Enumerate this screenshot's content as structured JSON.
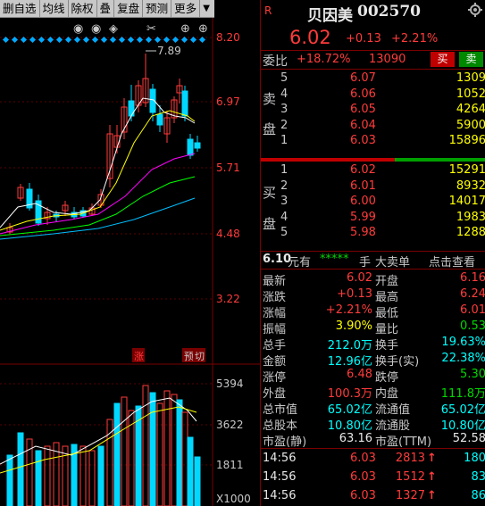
{
  "toolbar": {
    "items": [
      "删自选",
      "均线",
      "除权",
      "叠",
      "复盘",
      "预测",
      "更多"
    ],
    "dropdown_glyph": "▼"
  },
  "chart": {
    "price_axis": [
      "8.20",
      "6.97",
      "5.71",
      "4.48",
      "3.22"
    ],
    "volume_axis": [
      "5394",
      "3622",
      "1811"
    ],
    "volume_unit": "X1000",
    "high_marker": "7.89",
    "markers": [
      "涨",
      "预",
      "切"
    ]
  },
  "quote": {
    "flag": "R",
    "name": "贝因美",
    "code": "002570",
    "price": "6.02",
    "change": "+0.13",
    "change_pct": "+2.21%",
    "weibi_label": "委比",
    "weibi_value": "+18.72%",
    "weicha_value": "13090",
    "buy_button": "买",
    "sell_button": "卖"
  },
  "sell_side": {
    "side_label": [
      "卖",
      "盘"
    ],
    "rows": [
      {
        "level": "5",
        "price": "6.07",
        "volume": "1309"
      },
      {
        "level": "4",
        "price": "6.06",
        "volume": "1052"
      },
      {
        "level": "3",
        "price": "6.05",
        "volume": "4264"
      },
      {
        "level": "2",
        "price": "6.04",
        "volume": "5900"
      },
      {
        "level": "1",
        "price": "6.03",
        "volume": "15896"
      }
    ]
  },
  "buy_side": {
    "side_label": [
      "买",
      "盘"
    ],
    "rows": [
      {
        "level": "1",
        "price": "6.02",
        "volume": "15291"
      },
      {
        "level": "2",
        "price": "6.01",
        "volume": "8932"
      },
      {
        "level": "3",
        "price": "6.00",
        "volume": "14017"
      },
      {
        "level": "4",
        "price": "5.99",
        "volume": "1983"
      },
      {
        "level": "5",
        "price": "5.98",
        "volume": "1288"
      }
    ]
  },
  "big_order": {
    "price": "6.10",
    "unit": "元有",
    "stars": "*****",
    "hand": "手",
    "text": "大卖单",
    "link": "点击查看"
  },
  "stats": [
    {
      "l1": "最新",
      "v1": "6.02",
      "c1": "red",
      "l2": "开盘",
      "v2": "6.16",
      "c2": "red"
    },
    {
      "l1": "涨跌",
      "v1": "+0.13",
      "c1": "red",
      "l2": "最高",
      "v2": "6.24",
      "c2": "red"
    },
    {
      "l1": "涨幅",
      "v1": "+2.21%",
      "c1": "red",
      "l2": "最低",
      "v2": "6.01",
      "c2": "red"
    },
    {
      "l1": "振幅",
      "v1": "3.90%",
      "c1": "yel",
      "l2": "量比",
      "v2": "0.53",
      "c2": "grn"
    },
    {
      "l1": "总手",
      "v1": "212.0万",
      "c1": "cyn",
      "l2": "换手",
      "v2": "19.63%",
      "c2": "cyn"
    },
    {
      "l1": "金额",
      "v1": "12.96亿",
      "c1": "cyn",
      "l2": "换手(实)",
      "v2": "22.38%",
      "c2": "cyn"
    },
    {
      "l1": "涨停",
      "v1": "6.48",
      "c1": "red",
      "l2": "跌停",
      "v2": "5.30",
      "c2": "grn"
    },
    {
      "l1": "外盘",
      "v1": "100.3万",
      "c1": "red",
      "l2": "内盘",
      "v2": "111.8万",
      "c2": "grn"
    },
    {
      "l1": "总市值",
      "v1": "65.02亿",
      "c1": "cyn",
      "l2": "流通值",
      "v2": "65.02亿",
      "c2": "cyn"
    },
    {
      "l1": "总股本",
      "v1": "10.80亿",
      "c1": "cyn",
      "l2": "流通股",
      "v2": "10.80亿",
      "c2": "cyn"
    },
    {
      "l1": "市盈(静)",
      "v1": "63.16",
      "c1": "wht",
      "l2": "市盈(TTM)",
      "v2": "52.58",
      "c2": "wht"
    }
  ],
  "ticks": [
    {
      "time": "14:56",
      "price": "6.03",
      "volume": "2813",
      "arrow": "↑",
      "count": "180"
    },
    {
      "time": "14:56",
      "price": "6.03",
      "volume": "1512",
      "arrow": "↑",
      "count": "83"
    },
    {
      "time": "14:56",
      "price": "6.03",
      "volume": "1327",
      "arrow": "↑",
      "count": "86"
    }
  ],
  "colors": {
    "up": "#ff3b3b",
    "down": "#00d8ff",
    "bg": "#000000",
    "ma5": "#ffffff",
    "ma10": "#ffff00",
    "ma20": "#ff00ff",
    "ma60": "#00ff00",
    "ma120": "#00bfff"
  }
}
